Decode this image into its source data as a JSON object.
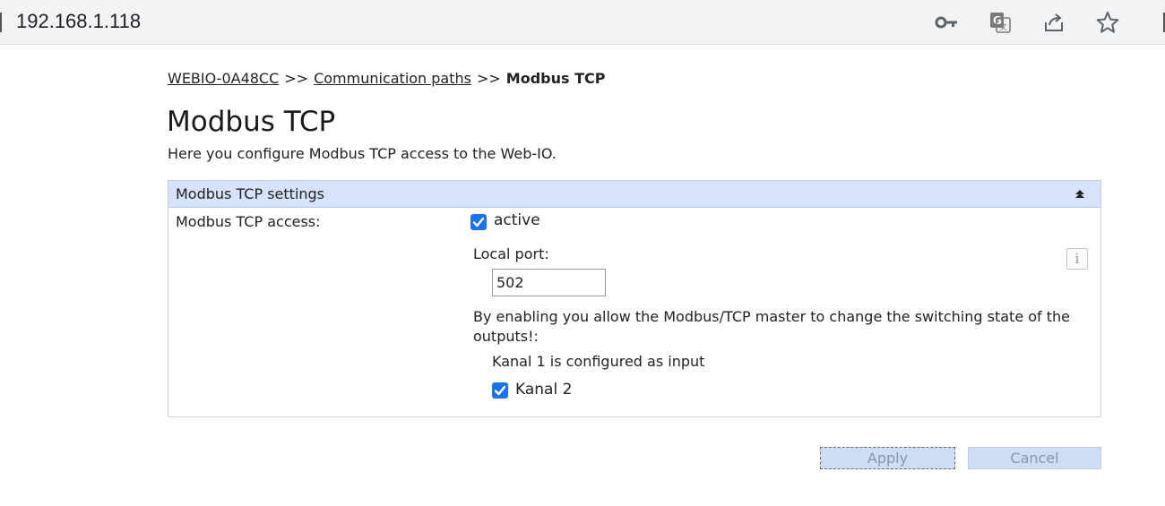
{
  "browser": {
    "url": "192.168.1.118",
    "icons": [
      "key-icon",
      "translate-icon",
      "share-icon",
      "star-icon"
    ]
  },
  "breadcrumb": {
    "root": "WEBIO-0A48CC",
    "separator": ">>",
    "parent": "Communication paths",
    "current": "Modbus TCP"
  },
  "page": {
    "title": "Modbus TCP",
    "description": "Here you configure Modbus TCP access to the Web-IO."
  },
  "panel": {
    "title": "Modbus TCP settings",
    "access_label": "Modbus TCP access:",
    "active_label": "active",
    "active_checked": true,
    "local_port_label": "Local port:",
    "local_port_value": "502",
    "note": "By enabling you allow the Modbus/TCP master to change the switching state of the outputs!:",
    "kanal1_text": "Kanal 1 is configured as input",
    "kanal2_label": "Kanal 2",
    "kanal2_checked": true
  },
  "buttons": {
    "apply": "Apply",
    "cancel": "Cancel"
  },
  "colors": {
    "panel_header": "#d6e3fa",
    "checkbox": "#1a73e8",
    "button_bg": "#cfdcf5"
  }
}
